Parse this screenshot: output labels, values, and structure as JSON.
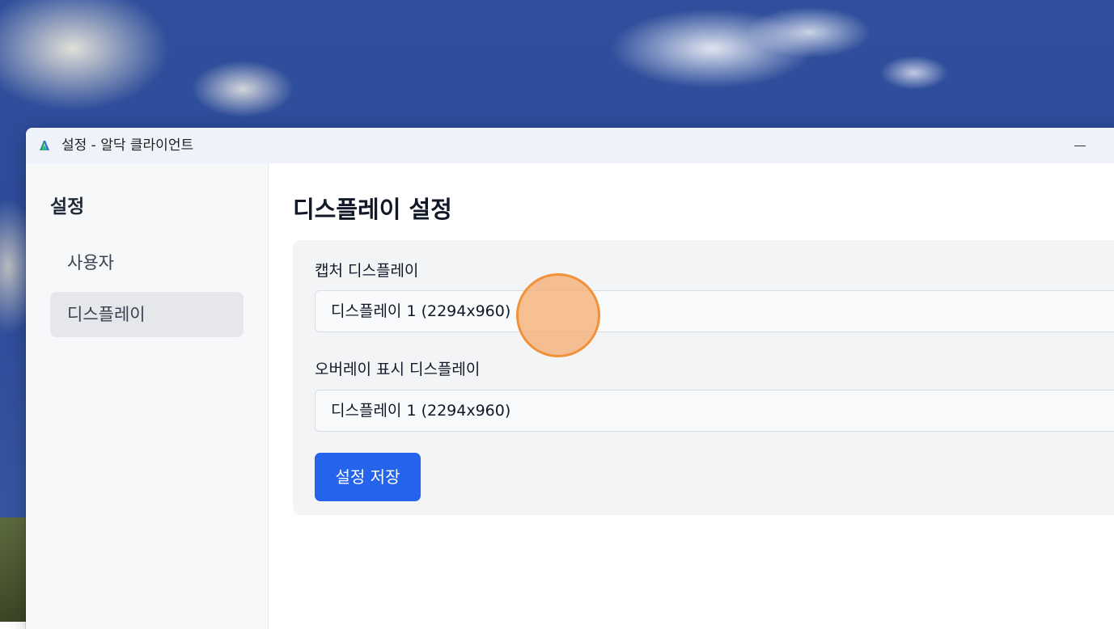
{
  "window": {
    "title": "설정 - 알닥 클라이언트",
    "minimize_glyph": "—"
  },
  "sidebar": {
    "title": "설정",
    "items": [
      {
        "label": "사용자",
        "active": false
      },
      {
        "label": "디스플레이",
        "active": true
      }
    ]
  },
  "main": {
    "page_title": "디스플레이 설정",
    "capture_display": {
      "label": "캡처 디스플레이",
      "value": "디스플레이 1 (2294x960)"
    },
    "overlay_display": {
      "label": "오버레이 표시 디스플레이",
      "value": "디스플레이 1 (2294x960)"
    },
    "save_button": "설정 저장"
  },
  "colors": {
    "accent": "#2563eb",
    "cursor_highlight": "#f0923a",
    "sidebar_active_bg": "#e5e7eb"
  },
  "icons": {
    "app": "app-logo-icon",
    "minimize": "minimize-icon"
  }
}
